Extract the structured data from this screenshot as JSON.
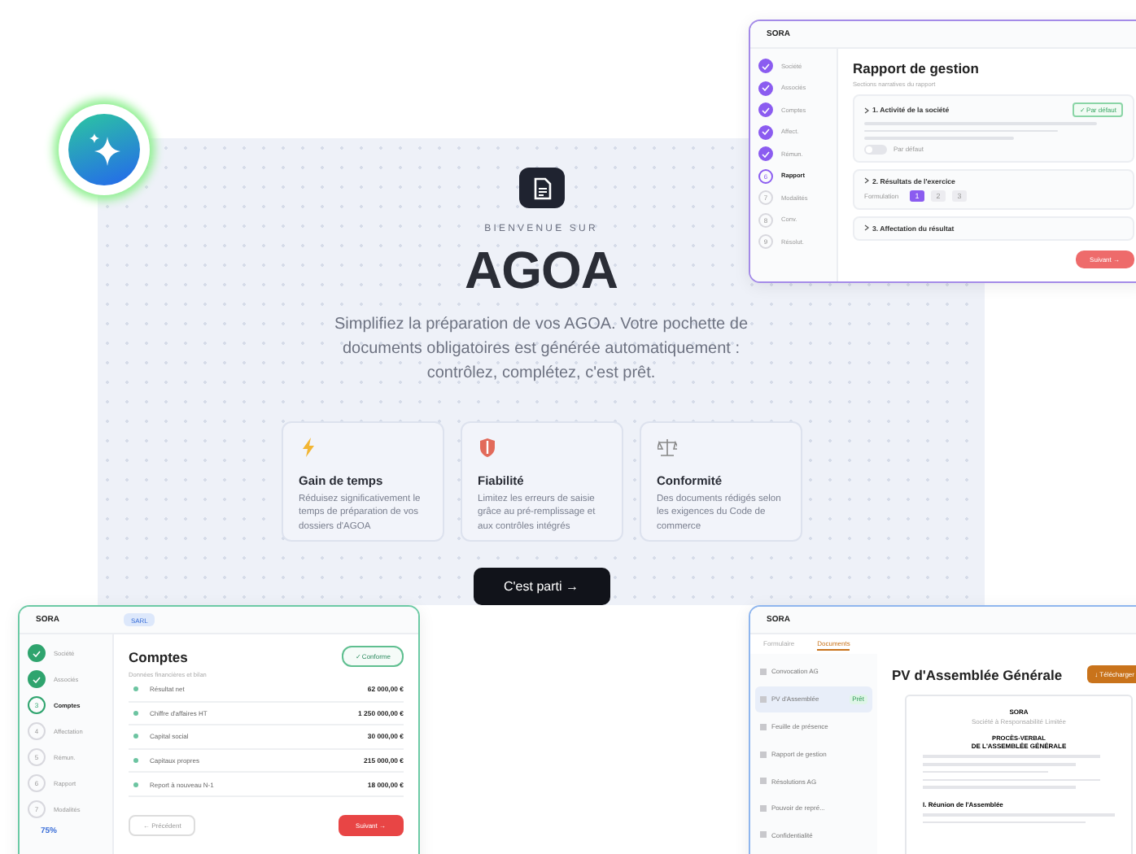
{
  "hero": {
    "kicker": "BIENVENUE SUR",
    "title": "AGOA",
    "description": "Simplifiez la préparation de vos AGOA. Votre pochette de documents obligatoires est générée automatiquement : contrôlez, complétez, c'est prêt.",
    "features": [
      {
        "kind": "bolt",
        "title": "Gain de temps",
        "text": "Réduisez significativement le temps de préparation de vos dossiers d'AGOA"
      },
      {
        "kind": "shield",
        "title": "Fiabilité",
        "text": "Limitez les erreurs de saisie grâce au pré-remplissage et aux contrôles intégrés"
      },
      {
        "kind": "scale",
        "title": "Conformité",
        "text": "Des documents rédigés selon les exigences du Code de commerce"
      }
    ],
    "cta": "C'est parti →"
  },
  "report_window": {
    "brand": "SORA",
    "steps": [
      {
        "label": "Société",
        "kind": "done"
      },
      {
        "label": "Associés",
        "kind": "done"
      },
      {
        "label": "Comptes",
        "kind": "done"
      },
      {
        "label": "Affect.",
        "kind": "done"
      },
      {
        "label": "Rémun.",
        "kind": "done"
      },
      {
        "label": "Rapport",
        "number": "6",
        "kind": "current"
      },
      {
        "label": "Modalités",
        "number": "7",
        "kind": "todo"
      },
      {
        "label": "Conv.",
        "number": "8",
        "kind": "todo"
      },
      {
        "label": "Résolut.",
        "number": "9",
        "kind": "todo"
      }
    ],
    "title": "Rapport de gestion",
    "subtitle": "Sections narratives du rapport",
    "sections": [
      {
        "kind": "text",
        "title": "1. Activité de la société",
        "badge": "✓ Par défaut",
        "toggle_label": "Par défaut",
        "on": false
      },
      {
        "kind": "choice",
        "title": "2. Résultats de l'exercice",
        "field_label": "Formulation",
        "options": [
          {
            "label": "1",
            "selected": true
          },
          {
            "label": "2",
            "selected": false
          },
          {
            "label": "3",
            "selected": false
          }
        ]
      },
      {
        "kind": "collapsed",
        "title": "3. Affectation du résultat"
      }
    ],
    "next": "Suivant →"
  },
  "accounts_window": {
    "brand": "SORA",
    "tag": "SARL",
    "steps": [
      {
        "label": "Société",
        "kind": "done"
      },
      {
        "label": "Associés",
        "kind": "done"
      },
      {
        "label": "Comptes",
        "number": "3",
        "kind": "current"
      },
      {
        "label": "Affectation",
        "number": "4",
        "kind": "todo"
      },
      {
        "label": "Rémun.",
        "number": "5",
        "kind": "todo"
      },
      {
        "label": "Rapport",
        "number": "6",
        "kind": "todo"
      },
      {
        "label": "Modalités",
        "number": "7",
        "kind": "todo"
      }
    ],
    "progress_label": "75%",
    "title": "Comptes",
    "status_button": "✓ Conforme",
    "subtitle": "Données financières et bilan",
    "rows": [
      {
        "label": "Résultat net",
        "value": "62 000,00 €"
      },
      {
        "label": "Chiffre d'affaires HT",
        "value": "1 250 000,00 €"
      },
      {
        "label": "Capital social",
        "value": "30 000,00 €"
      },
      {
        "label": "Capitaux propres",
        "value": "215 000,00 €"
      },
      {
        "label": "Report à nouveau N-1",
        "value": "18 000,00 €"
      }
    ],
    "previous": "← Précédent",
    "next": "Suivant →"
  },
  "documents_window": {
    "brand": "SORA",
    "tabs": [
      {
        "label": "Formulaire",
        "selected": false
      },
      {
        "label": "Documents",
        "selected": true
      }
    ],
    "documents": [
      {
        "label": "Convocation AG",
        "selected": false
      },
      {
        "label": "PV d'Assemblée",
        "selected": true,
        "badge": "Prêt"
      },
      {
        "label": "Feuille de présence",
        "selected": false
      },
      {
        "label": "Rapport de gestion",
        "selected": false
      },
      {
        "label": "Résolutions AG",
        "selected": false
      },
      {
        "label": "Pouvoir de repré...",
        "selected": false
      },
      {
        "label": "Confidentialité",
        "selected": false
      }
    ],
    "title": "PV d'Assemblée Générale",
    "download": "↓ Télécharger",
    "preview": {
      "company": "SORA",
      "company_type": "Société à Responsabilité Limitée",
      "heading": "PROCÈS-VERBAL",
      "subheading": "DE L'ASSEMBLÉE GÉNÉRALE",
      "section": "I. Réunion de l'Assemblée"
    }
  }
}
